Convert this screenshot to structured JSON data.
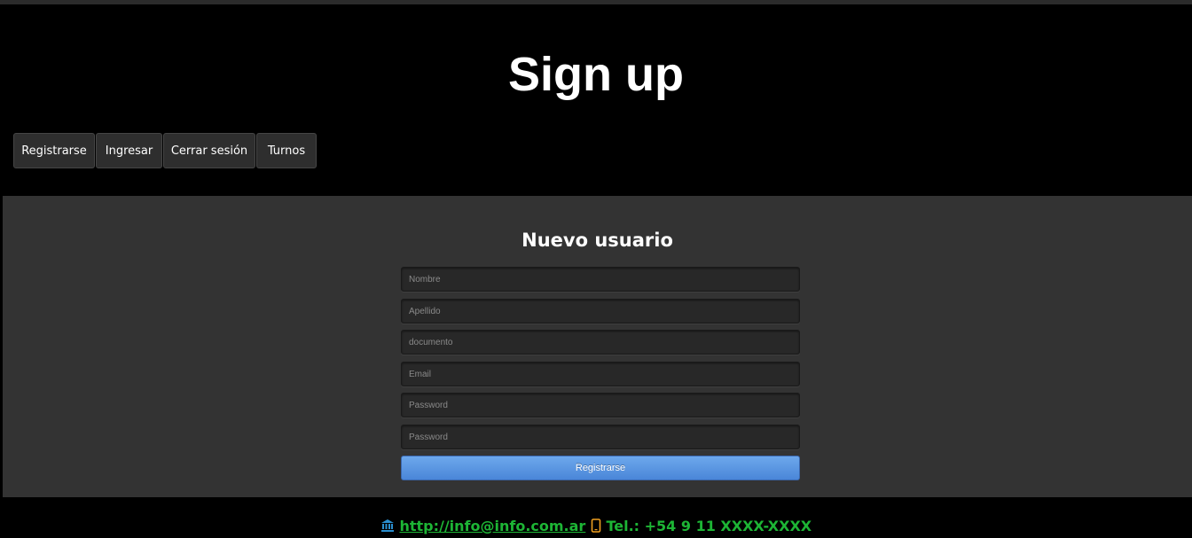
{
  "header": {
    "title": "Sign up",
    "nav": [
      {
        "label": "Registrarse"
      },
      {
        "label": "Ingresar"
      },
      {
        "label": "Cerrar sesión"
      },
      {
        "label": "Turnos"
      }
    ]
  },
  "form": {
    "title": "Nuevo usuario",
    "fields": [
      {
        "placeholder": "Nombre",
        "value": ""
      },
      {
        "placeholder": "Apellido",
        "value": ""
      },
      {
        "placeholder": "documento",
        "value": ""
      },
      {
        "placeholder": "Email",
        "value": ""
      },
      {
        "placeholder": "Password",
        "value": ""
      },
      {
        "placeholder": "Password",
        "value": ""
      }
    ],
    "submit_label": "Registrarse"
  },
  "footer": {
    "link_text": "http://info@info.com.ar",
    "phone_text": "Tel.: +54 9 11 XXXX-XXXX",
    "icons": [
      "bank-icon",
      "mobile-phone-icon"
    ]
  },
  "colors": {
    "header_bg": "#000000",
    "main_bg": "#333333",
    "footer_text": "#1db535",
    "button_blue": "#4a86d8"
  }
}
